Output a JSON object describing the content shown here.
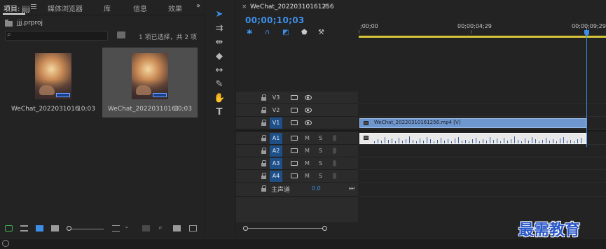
{
  "project_panel": {
    "tabs": [
      {
        "label": "项目: jjjj"
      },
      {
        "label": "媒体浏览器"
      },
      {
        "label": "库"
      },
      {
        "label": "信息"
      },
      {
        "label": "效果"
      }
    ],
    "more_label": "»",
    "project_file": "jjj.prproj",
    "search_placeholder": "",
    "item_count": "1 项已选择，共 2 项",
    "clips": [
      {
        "name": "WeChat_202203101612...",
        "duration": "10;03",
        "selected": false
      },
      {
        "name": "WeChat_20220310161256",
        "duration": "10;03",
        "selected": true
      }
    ]
  },
  "timeline": {
    "sequence_name": "WeChat_20220310161256",
    "close_label": "×",
    "menu_label": "≡",
    "timecode": "00;00;10;03",
    "ruler_labels": [
      ";00;00",
      "00;00;04;29",
      "00;00;09;29"
    ],
    "tracks": [
      {
        "name": "V3",
        "type": "video",
        "targeted": false,
        "source": false
      },
      {
        "name": "V2",
        "type": "video",
        "targeted": false,
        "source": false
      },
      {
        "name": "V1",
        "type": "video",
        "targeted": true,
        "source": true
      },
      {
        "name": "A1",
        "type": "audio",
        "targeted": true,
        "source": true
      },
      {
        "name": "A2",
        "type": "audio",
        "targeted": true,
        "source": false
      },
      {
        "name": "A3",
        "type": "audio",
        "targeted": true,
        "source": false
      },
      {
        "name": "A4",
        "type": "audio",
        "targeted": true,
        "source": false
      }
    ],
    "mute_label": "M",
    "solo_label": "S",
    "video_clip_label": "WeChat_20220310161256.mp4 [V]",
    "master": {
      "label": "主声道",
      "value": "0.0"
    }
  },
  "watermark": "最需教育",
  "colors": {
    "accent": "#3d8ee8",
    "track_target": "#1e4f86",
    "video_clip": "#6e96cf",
    "work_area": "#d4c43a",
    "watermark": "#2b58c8"
  }
}
